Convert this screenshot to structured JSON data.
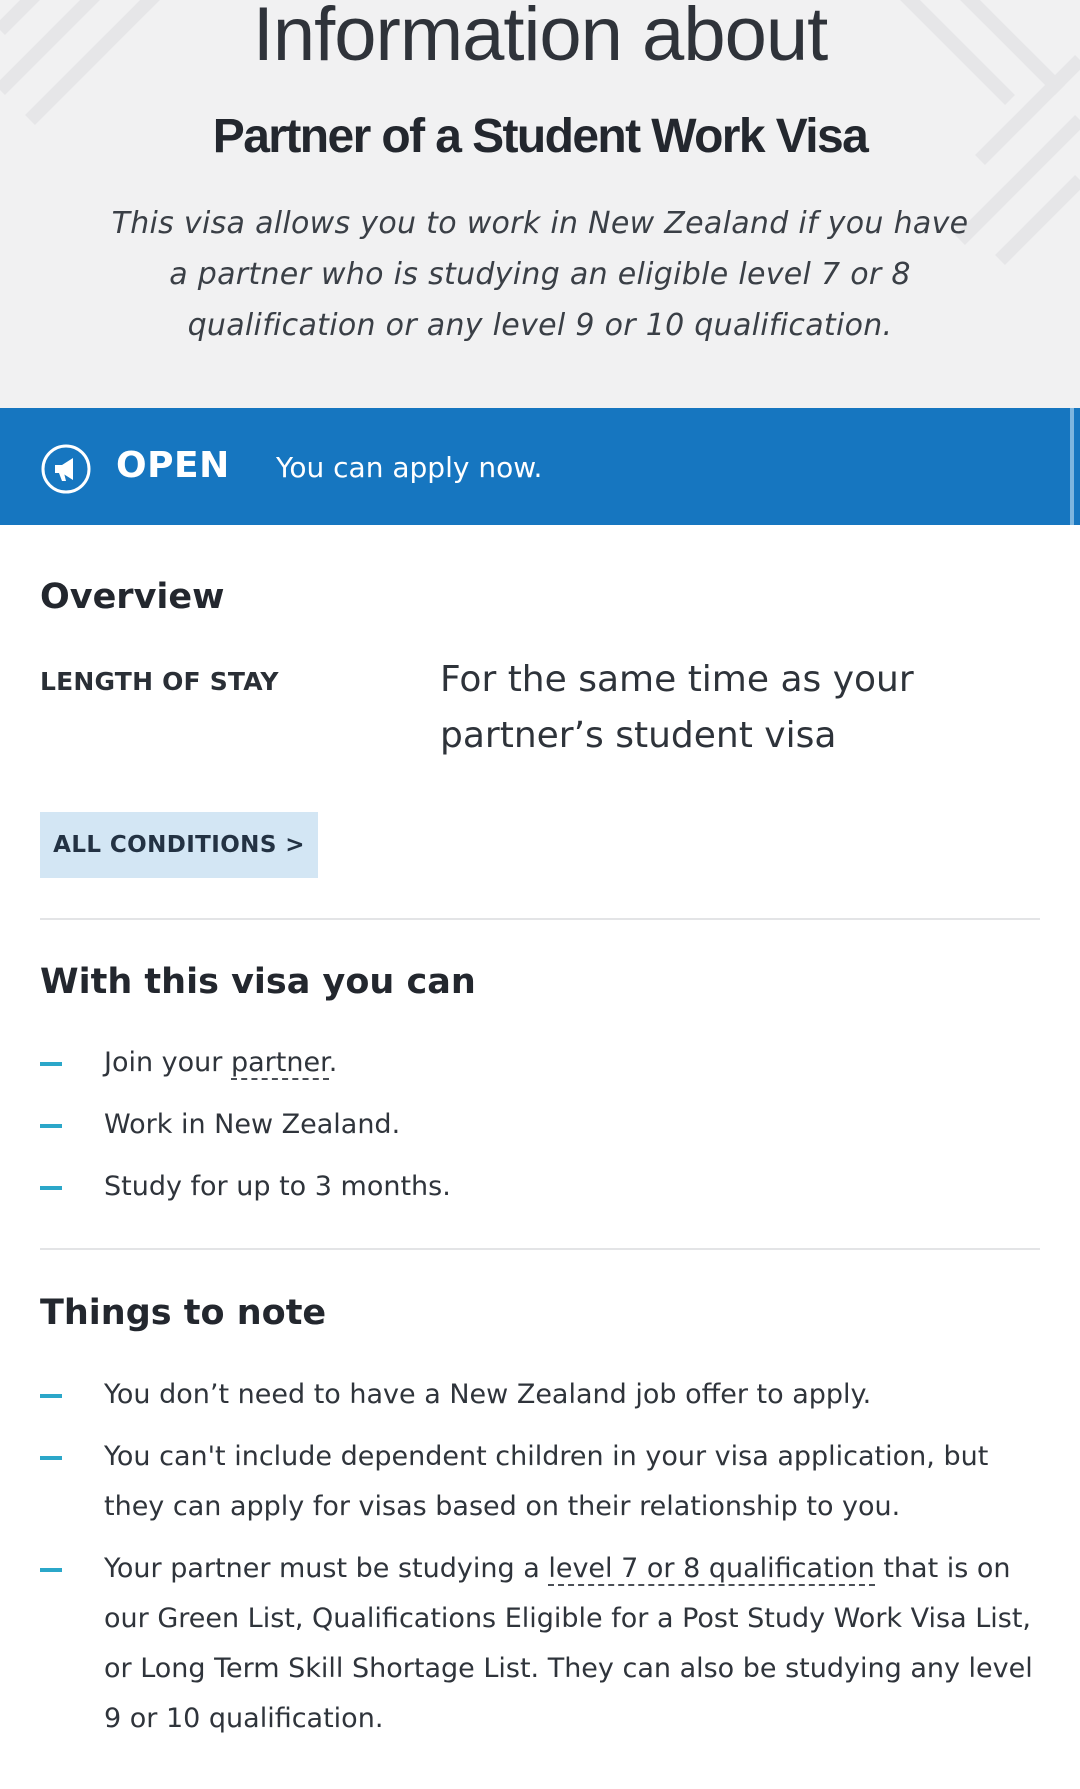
{
  "hero": {
    "pretitle": "Information about",
    "title": "Partner of a Student Work Visa",
    "description": "This visa allows you to work in New Zealand if you have a partner who is studying an eligible level 7 or 8 qualification or any level 9 or 10 qualification."
  },
  "status": {
    "icon": "megaphone-icon",
    "label": "OPEN",
    "message": "You can apply now.",
    "color": "#1676c0"
  },
  "overview": {
    "heading": "Overview",
    "length_label": "LENGTH OF STAY",
    "length_value": "For the same time as your partner’s student visa",
    "conditions_button": "ALL CONDITIONS >"
  },
  "can": {
    "heading": "With this visa you can",
    "items": [
      {
        "before": "Join your ",
        "link": "partner",
        "after": "."
      },
      {
        "text": "Work in New Zealand."
      },
      {
        "text": "Study for up to 3 months."
      }
    ]
  },
  "notes": {
    "heading": "Things to note",
    "items": [
      {
        "text": "You don’t need to have a New Zealand job offer to apply."
      },
      {
        "text": "You can't include dependent children in your visa application, but they can apply for visas based on their relationship to you."
      },
      {
        "before": "Your partner must be studying a ",
        "link": "level 7 or 8 qualification",
        "after": " that is on our Green List, Qualifications Eligible for a Post Study Work Visa List, or Long Term Skill Shortage List. They can also be studying any level 9 or 10 qualification."
      }
    ]
  },
  "colors": {
    "accent_dash": "#2ba7c9",
    "button_bg": "#d3e6f4",
    "hero_bg": "#f1f1f2"
  }
}
